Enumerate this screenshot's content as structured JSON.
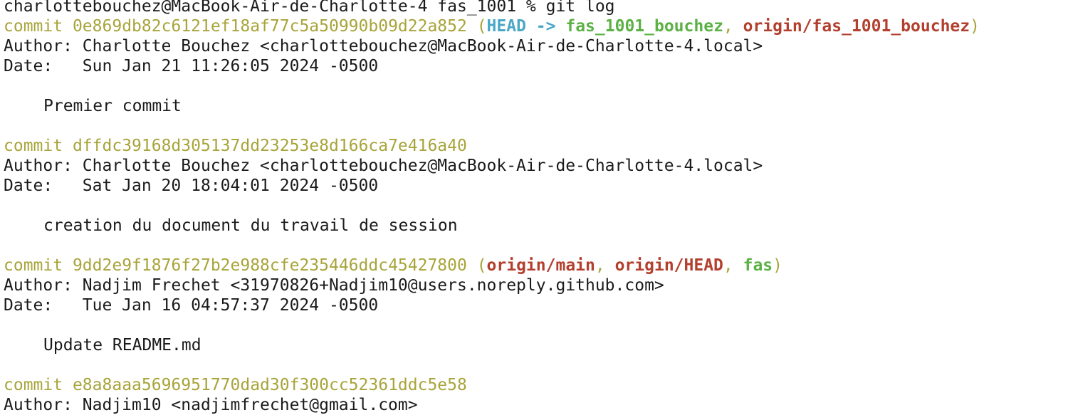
{
  "prompt": {
    "text": "charlottebouchez@MacBook-Air-de-Charlotte-4 fas_1001 % git log"
  },
  "commits": [
    {
      "commit_label": "commit",
      "hash": "0e869db82c6121ef18af77c5a50990b09d22a852",
      "refs": {
        "head": "HEAD",
        "arrow": "->",
        "local_branch": "fas_1001_bouchez",
        "remote_branch": "origin/fas_1001_bouchez"
      },
      "author_line": "Author: Charlotte Bouchez <charlottebouchez@MacBook-Air-de-Charlotte-4.local>",
      "date_line": "Date:   Sun Jan 21 11:26:05 2024 -0500",
      "message": "Premier commit"
    },
    {
      "commit_label": "commit",
      "hash": "dffdc39168d305137dd23253e8d166ca7e416a40",
      "author_line": "Author: Charlotte Bouchez <charlottebouchez@MacBook-Air-de-Charlotte-4.local>",
      "date_line": "Date:   Sat Jan 20 18:04:01 2024 -0500",
      "message": "creation du document du travail de session"
    },
    {
      "commit_label": "commit",
      "hash": "9dd2e9f1876f27b2e988cfe235446ddc45427800",
      "refs": {
        "remote_main": "origin/main",
        "remote_head": "origin/HEAD",
        "local_branch": "fas"
      },
      "author_line": "Author: Nadjim Frechet <31970826+Nadjim10@users.noreply.github.com>",
      "date_line": "Date:   Tue Jan 16 04:57:37 2024 -0500",
      "message": "Update README.md"
    },
    {
      "commit_label": "commit",
      "hash": "e8a8aaa5696951770dad30f300cc52361ddc5e58",
      "author_line": "Author: Nadjim10 <nadjimfrechet@gmail.com>"
    }
  ],
  "colors": {
    "hash": "#a8a43a",
    "head": "#4aa8c7",
    "local_branch": "#5cb145",
    "remote_branch": "#b3402e",
    "text": "#1a1a1a",
    "background": "#ffffff"
  }
}
